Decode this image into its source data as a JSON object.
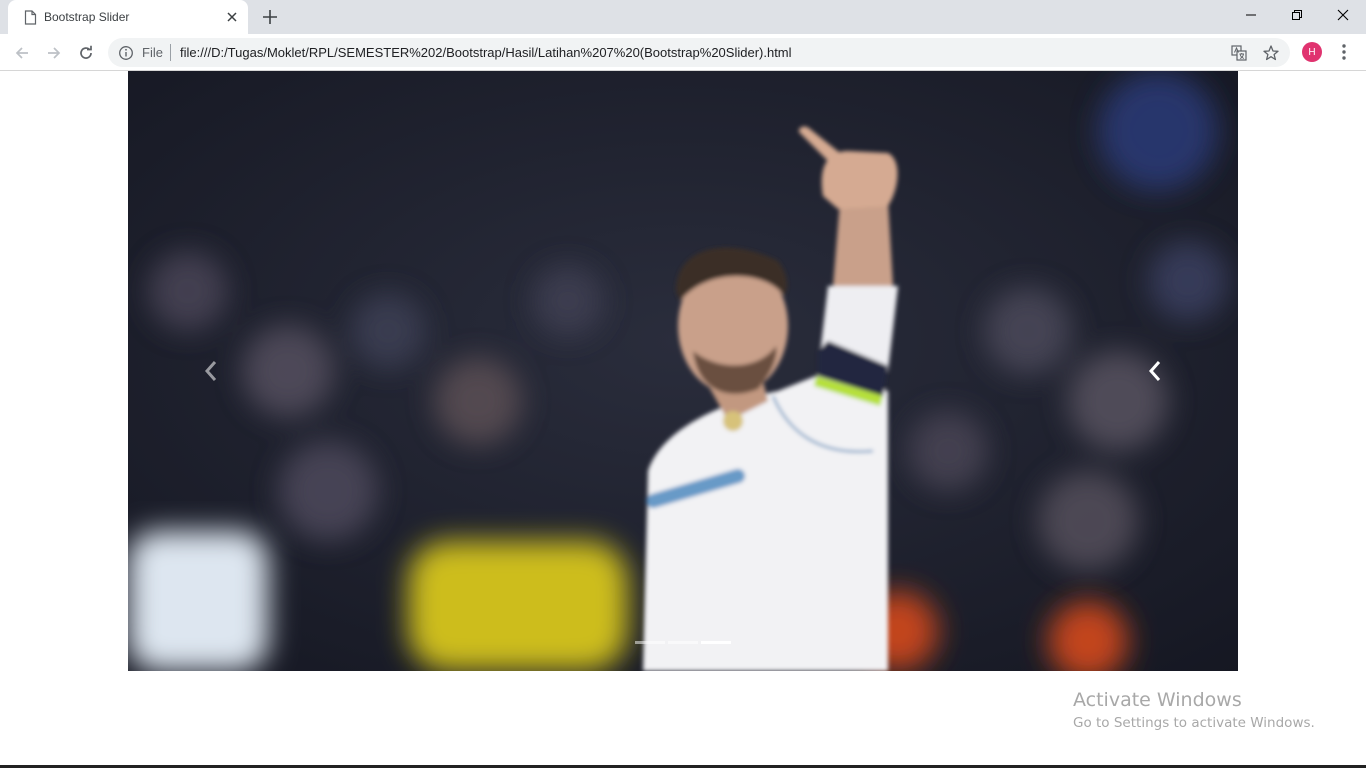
{
  "browser": {
    "tab": {
      "title": "Bootstrap Slider",
      "favicon": "file-icon"
    },
    "new_tab_icon": "plus-icon",
    "window_controls": [
      "minimize-icon",
      "restore-icon",
      "close-icon"
    ],
    "toolbar": {
      "scheme_label": "File",
      "url": "file:///D:/Tugas/Moklet/RPL/SEMESTER%202/Bootstrap/Hasil/Latihan%207%20(Bootstrap%20Slider).html",
      "profile_initial": "H",
      "profile_color": "#e0336f"
    }
  },
  "carousel": {
    "slide_count": 3,
    "active_index": 0,
    "prev_icon": "chevron-left-icon",
    "next_icon": "chevron-left-icon"
  },
  "watermark": {
    "title": "Activate Windows",
    "subtitle": "Go to Settings to activate Windows."
  }
}
